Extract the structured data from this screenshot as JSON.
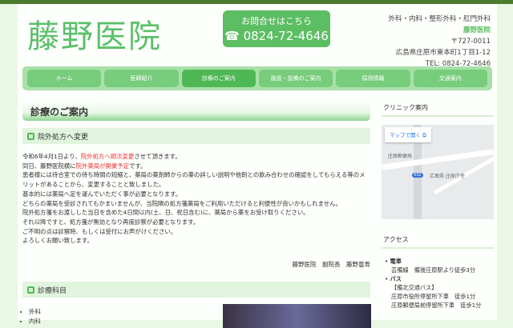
{
  "header": {
    "logo": "藤野医院",
    "contact_label": "お問合せはこちら",
    "contact_phone": "☎ 0824-72-4646",
    "departments": "外科・内科・整形外科・肛門外科",
    "clinic_name": "藤野医院",
    "postal": "〒727-0011",
    "address": "広島県庄原市東本町1丁目1-12",
    "tel": "TEL: 0824-72-4646"
  },
  "nav": [
    "ホーム",
    "医師紹介",
    "診療のご案内",
    "施設・設備のご案内",
    "採用情報",
    "交通案内"
  ],
  "main": {
    "title": "診療のご案内",
    "section1": "院外処方へ変更",
    "p1a": "令和6年4月1日より、",
    "p1red": "院外処方へ順次変更",
    "p1b": "させて頂きます。",
    "p2a": "同日、藤野医院横に",
    "p2red": "院外薬局が開業予定",
    "p2b": "です。",
    "lines": [
      "患者様には待合室での待ち時間の短縮と、薬局の薬剤師からの薬の詳しい説明や他剤との飲み合わせの確認をしてもらえる等のメリットがあることから、変更することと致しました。",
      "基本的には薬局へ足を運んでいただく事が必要となります。",
      "どちらの薬局を受診されてもかまいませんが、当院隣の処方箋薬局をご利用いただけると利便性が良いかもしれません。",
      "院外処方箋をお渡しした当日を含めた4日間以内(土、日、祝日含む)に、薬局から薬をお受け取りください。",
      "それ以降ですと、処方箋が無効となり再度診察が必要となります。",
      "ご不明の点は診察時、もしくは受付にお声がけください。",
      "よろしくお願い致します。"
    ],
    "signature": "藤野医院　副院長　藤野豊寿",
    "section2": "診療科目",
    "subjects": [
      "外科",
      "内科"
    ]
  },
  "sidebar": {
    "clinic_heading": "クリニック案内",
    "map_button": "マップで開く ⧉",
    "map_poi1": "庄原郵便局",
    "map_poi2": "広島県 庄原庁舎",
    "map_road": "432",
    "access_heading": "アクセス",
    "train_label": "電車",
    "train_text": "芸備線　備後庄原駅より徒歩3分",
    "bus_label": "バス",
    "bus_company": "【備北交通バス】",
    "bus_line1": "庄原市役所停留所下車　徒歩1分",
    "bus_line2": "庄原郵便局前停留所下車　徒歩1分"
  }
}
